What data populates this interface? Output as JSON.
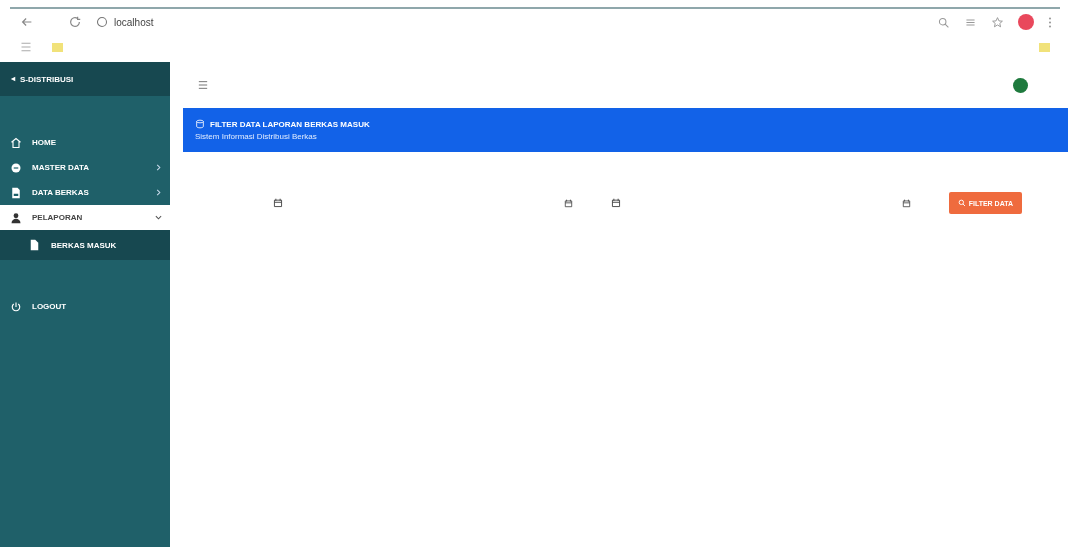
{
  "browser": {
    "address": "localhost"
  },
  "sidebar": {
    "brand": "S-DISTRIBUSI",
    "items": [
      {
        "label": "HOME",
        "kind": "link",
        "selected": false
      },
      {
        "label": "MASTER DATA",
        "kind": "submenu",
        "selected": false,
        "expanded": false
      },
      {
        "label": "DATA BERKAS",
        "kind": "submenu",
        "selected": false,
        "expanded": false
      },
      {
        "label": "PELAPORAN",
        "kind": "submenu",
        "selected": true,
        "expanded": true,
        "children": [
          {
            "label": "BERKAS MASUK",
            "selected": true
          }
        ]
      },
      {
        "label": "LOGOUT",
        "kind": "link",
        "selected": false
      }
    ]
  },
  "banner": {
    "title": "FILTER DATA LAPORAN BERKAS MASUK",
    "subtitle": "Sistem Informasi Distribusi Berkas"
  },
  "filter": {
    "fields": [
      {
        "kind": "date"
      },
      {
        "kind": "date"
      }
    ],
    "button": "FILTER DATA"
  }
}
